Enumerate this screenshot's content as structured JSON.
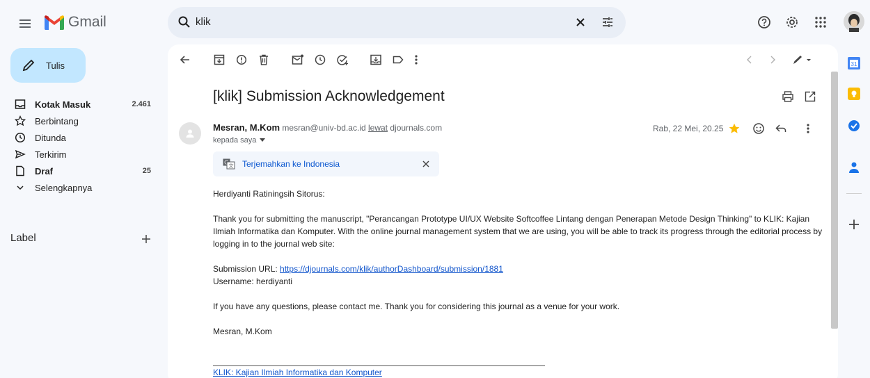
{
  "app": {
    "name": "Gmail"
  },
  "search": {
    "query": "klik"
  },
  "compose": {
    "label": "Tulis"
  },
  "sidebar": {
    "items": [
      {
        "label": "Kotak Masuk",
        "count": "2.461",
        "bold": true,
        "icon": "inbox-icon"
      },
      {
        "label": "Berbintang",
        "count": "",
        "bold": false,
        "icon": "star-outline-icon"
      },
      {
        "label": "Ditunda",
        "count": "",
        "bold": false,
        "icon": "clock-icon"
      },
      {
        "label": "Terkirim",
        "count": "",
        "bold": false,
        "icon": "send-icon"
      },
      {
        "label": "Draf",
        "count": "25",
        "bold": true,
        "icon": "draft-icon"
      },
      {
        "label": "Selengkapnya",
        "count": "",
        "bold": false,
        "icon": "chevron-down-icon"
      }
    ],
    "label_heading": "Label"
  },
  "email": {
    "subject": "[klik] Submission Acknowledgement",
    "sender_name": "Mesran, M.Kom",
    "sender_email": "mesran@univ-bd.ac.id",
    "via_label": "lewat",
    "via_domain": "djournals.com",
    "to_line": "kepada saya",
    "date": "Rab, 22 Mei, 20.25",
    "translate_label": "Terjemahkan ke Indonesia",
    "greeting": "Herdiyanti Ratiningsih Sitorus:",
    "paragraph1": "Thank you for submitting the manuscript, \"Perancangan Prototype UI/UX Website Softcoffee Lintang dengan Penerapan Metode Design Thinking\" to KLIK: Kajian Ilmiah Informatika dan Komputer. With the online journal management system that we are using, you will be able to track its progress through the editorial process by logging in to the journal web site:",
    "submission_label": "Submission URL:",
    "submission_url": "https://djournals.com/klik/authorDashboard/submission/1881",
    "username_line": "Username: herdiyanti",
    "paragraph2": "If you have any questions, please contact me. Thank you for considering this journal as a venue for your work.",
    "signature": "Mesran, M.Kom",
    "footer_link": "KLIK: Kajian Ilmiah Informatika dan Komputer"
  },
  "colors": {
    "background": "#f6f8fc",
    "compose_bg": "#c2e7ff",
    "search_bg": "#e9eef6",
    "link": "#1155cc",
    "star": "#fbbc04"
  }
}
